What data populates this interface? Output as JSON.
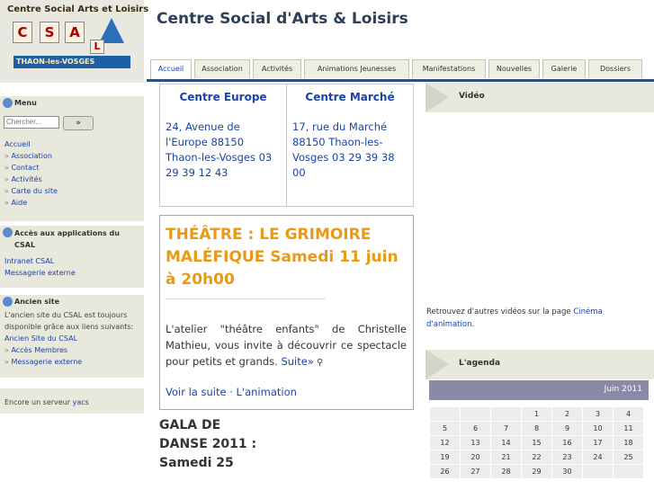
{
  "logo": {
    "top_text": "Centre Social Arts et Loisirs",
    "letters": [
      "C",
      "S",
      "A",
      "L"
    ],
    "bottom_text": "THAON-les-VOSGES"
  },
  "site_title": "Centre Social d'Arts & Loisirs",
  "tabs": [
    {
      "label": "Accueil",
      "active": true
    },
    {
      "label": "Association"
    },
    {
      "label": "Activités"
    },
    {
      "label": "Animations Jeunesses"
    },
    {
      "label": "Manifestations"
    },
    {
      "label": "Nouvelles"
    },
    {
      "label": "Galerie"
    },
    {
      "label": "Dossiers"
    }
  ],
  "menu": {
    "title": "Menu",
    "search_placeholder": "Chercher...",
    "search_button": "»",
    "items": [
      "Accueil",
      "Association",
      "Contact",
      "Activités",
      "Carte du site",
      "Aide"
    ]
  },
  "apps": {
    "title": "Accès aux applications du CSAL",
    "items": [
      "Intranet CSAL",
      "Messagerie externe"
    ]
  },
  "old_site": {
    "title": "Ancien site",
    "text": "L'ancien site du CSAL est toujours disponible grâce aux liens suivants:",
    "link": "Ancien Site du CSAL",
    "items": [
      "Accès Membres",
      "Messagerie externe"
    ]
  },
  "server": {
    "text": "Encore un serveur",
    "link": "yacs"
  },
  "centres": [
    {
      "name": "Centre Europe",
      "address": "24, Avenue de l'Europe 88150 Thaon-les-Vosges 03 29 39 12 43"
    },
    {
      "name": "Centre Marché",
      "address": "17, rue du Marché 88150 Thaon-les-Vosges 03 29 39 38 00"
    }
  ],
  "theatre": {
    "title": "THÉÂTRE : LE GRIMOIRE MALÉFIQUE Samedi 11 juin à 20h00",
    "body": "L'atelier \"théâtre enfants\" de Christelle Mathieu, vous invite à découvrir ce spectacle pour petits et grands.",
    "suite": "Suite»",
    "more": "Voir la suite",
    "sep": " · ",
    "tag": "L'animation"
  },
  "gala": "GALA DE DANSE 2011 : Samedi 25",
  "video": {
    "title": "Vidéo",
    "note_text": "Retrouvez d'autres vidéos sur la page",
    "note_link": "Cinéma d'animation",
    "note_end": "."
  },
  "agenda": {
    "title": "L'agenda",
    "month": "Juin 2011",
    "weeks": [
      [
        "",
        "",
        "",
        "1",
        "2",
        "3",
        "4"
      ],
      [
        "5",
        "6",
        "7",
        "8",
        "9",
        "10",
        "11"
      ],
      [
        "12",
        "13",
        "14",
        "15",
        "16",
        "17",
        "18"
      ],
      [
        "19",
        "20",
        "21",
        "22",
        "23",
        "24",
        "25"
      ],
      [
        "26",
        "27",
        "28",
        "29",
        "30",
        "",
        ""
      ]
    ]
  },
  "colors": {
    "accent": "#1a44a8",
    "theatre": "#e89a16",
    "sidebar_bg": "#e8e8dc",
    "tab_line": "#2d4e80",
    "agenda_head": "#8a8aa6"
  }
}
